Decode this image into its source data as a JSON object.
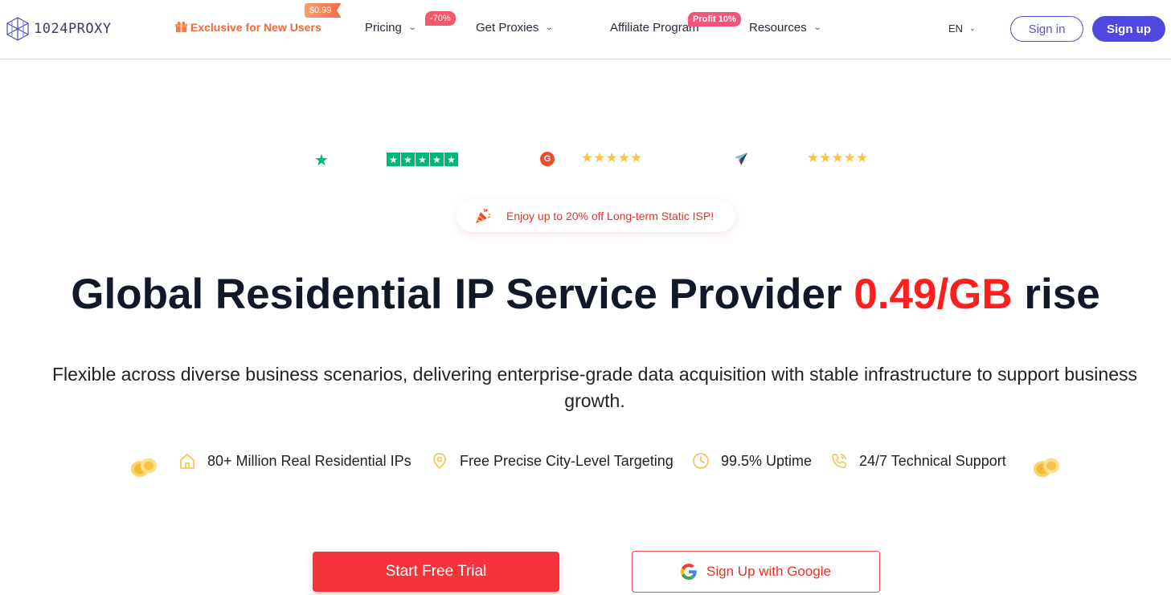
{
  "header": {
    "logo_text": "1024PROXY",
    "nav": {
      "exclusive": "Exclusive for New Users",
      "exclusive_badge": "$0.99",
      "pricing": "Pricing",
      "pricing_badge": "-70%",
      "get_proxies": "Get Proxies",
      "affiliate": "Affiliate Program",
      "affiliate_badge": "Profit 10%",
      "resources": "Resources"
    },
    "lang": "EN",
    "signin": "Sign in",
    "signup": "Sign up"
  },
  "ratings": {
    "trustpilot": "★★★★★",
    "g2": "★★★★★",
    "capterra": "★★★★★"
  },
  "promo": {
    "text": "Enjoy up to 20% off Long-term Static ISP!"
  },
  "hero": {
    "title_main": "Global Residential IP Service Provider ",
    "title_highlight": "0.49/GB",
    "title_end": " rise",
    "subtitle": "Flexible across diverse business scenarios, delivering enterprise-grade data acquisition with stable infrastructure to support business growth."
  },
  "features": [
    {
      "label": "80+ Million Real Residential IPs",
      "icon": "home-icon"
    },
    {
      "label": "Free Precise City-Level Targeting",
      "icon": "location-pin-icon"
    },
    {
      "label": "99.5% Uptime",
      "icon": "clock-icon"
    },
    {
      "label": "24/7 Technical Support",
      "icon": "phone-icon"
    }
  ],
  "cta": {
    "trial": "Start Free Trial",
    "google": "Sign Up with Google"
  },
  "colors": {
    "brand": "#5048e0",
    "accent_red": "#f5333a",
    "highlight": "#ff1e1e",
    "trustpilot_green": "#00b67a",
    "star_gold": "#f6c343"
  }
}
